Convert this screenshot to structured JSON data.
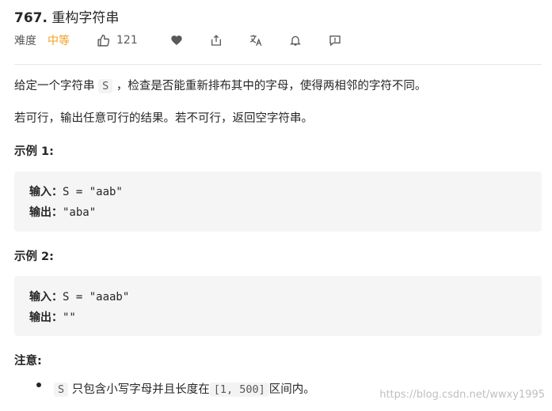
{
  "problem": {
    "number": "767.",
    "title": "重构字符串"
  },
  "meta": {
    "difficulty_label": "难度",
    "difficulty": "中等",
    "likes": "121",
    "icons": [
      "thumbs-up-icon",
      "heart-icon",
      "share-icon",
      "translate-icon",
      "bell-icon",
      "comment-icon"
    ]
  },
  "description": {
    "p1_before": "给定一个字符串 ",
    "p1_code": "S",
    "p1_after": " ，检查是否能重新排布其中的字母，使得两相邻的字符不同。",
    "p2": "若可行，输出任意可行的结果。若不可行，返回空字符串。"
  },
  "examples": [
    {
      "heading": "示例 1:",
      "input_label": "输入：",
      "input_value": "S = \"aab\"",
      "output_label": "输出：",
      "output_value": "\"aba\""
    },
    {
      "heading": "示例 2:",
      "input_label": "输入：",
      "input_value": "S = \"aaab\"",
      "output_label": "输出：",
      "output_value": "\"\""
    }
  ],
  "note": {
    "heading": "注意:",
    "item_code": "S",
    "item_mid": " 只包含小写字母并且长度在",
    "item_range": "[1, 500]",
    "item_end": "区间内。"
  },
  "watermark": "https://blog.csdn.net/wwxy1995",
  "colors": {
    "difficulty": "#f0a020",
    "text": "#262626",
    "code_bg": "#f5f5f5"
  }
}
